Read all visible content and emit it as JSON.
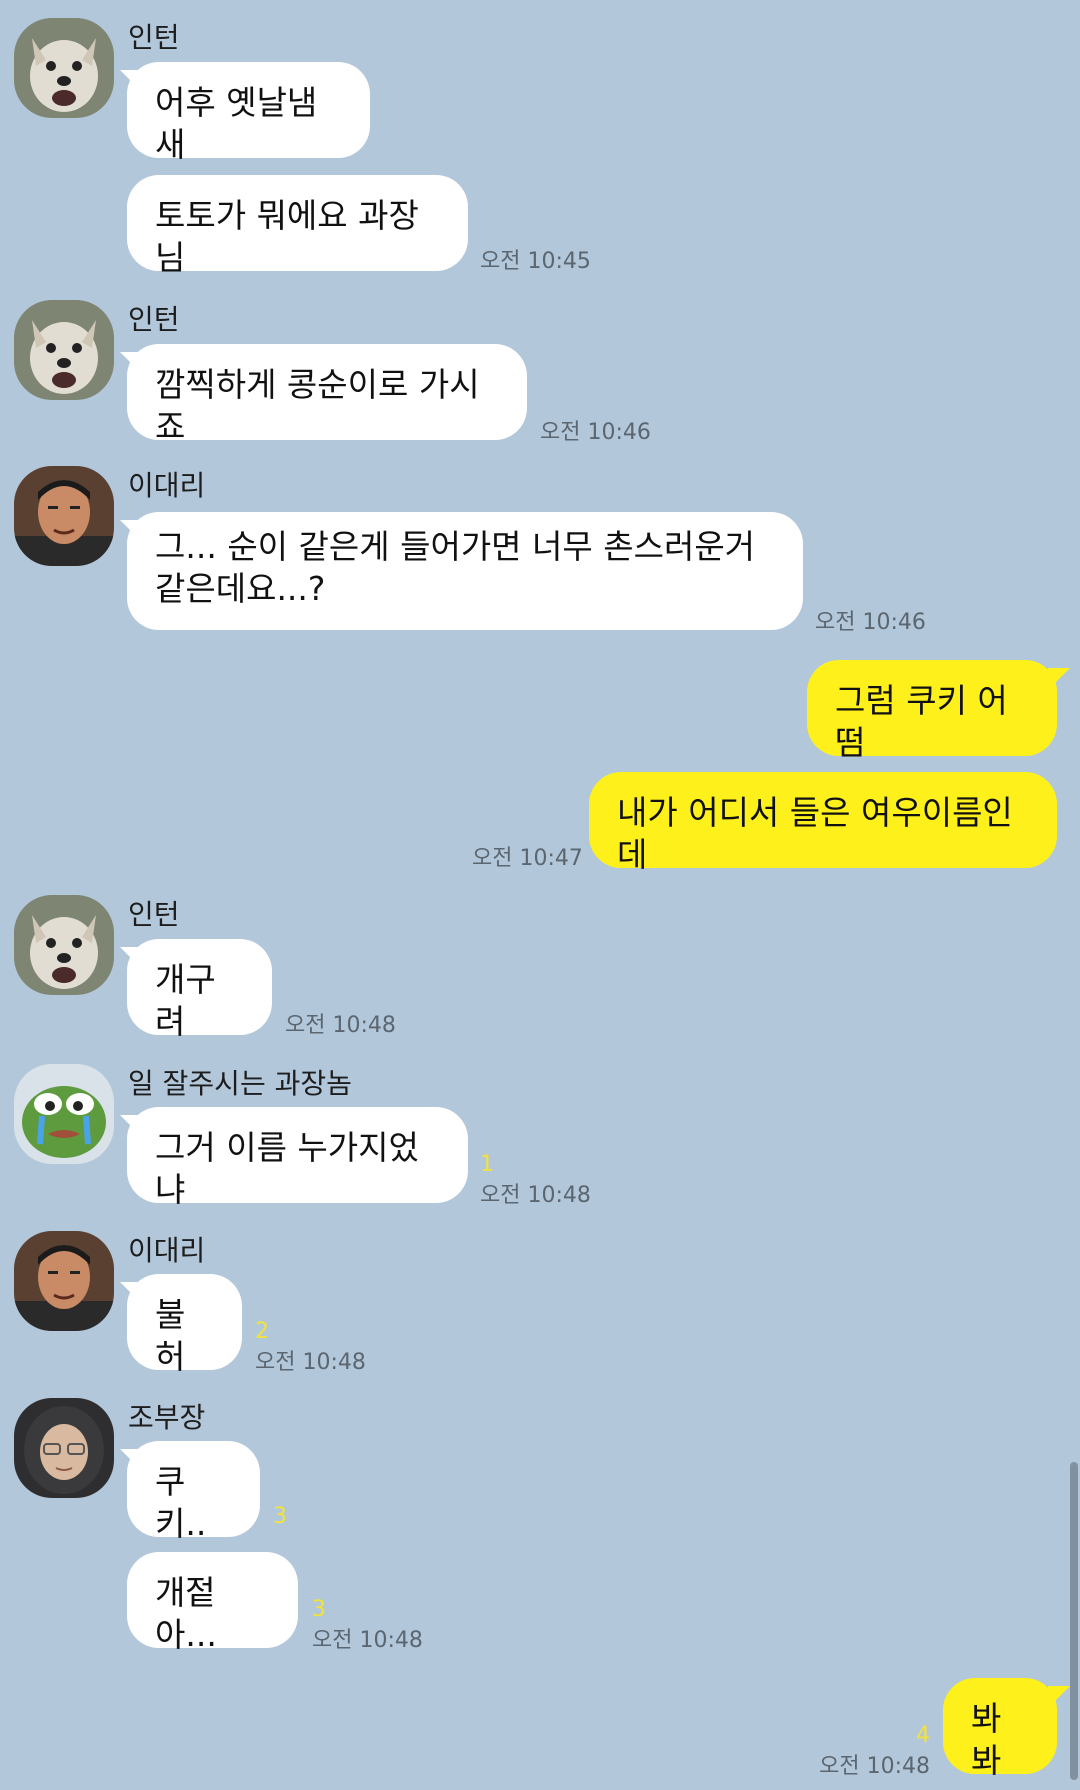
{
  "colors": {
    "background": "#b2c7da",
    "incoming_bubble": "#ffffff",
    "outgoing_bubble": "#fef01b",
    "unread_count": "#f3e23b"
  },
  "messages": [
    {
      "sender": "인턴",
      "avatar": "dog-avatar-icon",
      "bubbles": [
        {
          "text": "어후 옛날냄새"
        },
        {
          "text": "토토가 뭐에요 과장님",
          "time": "오전 10:45"
        }
      ]
    },
    {
      "sender": "인턴",
      "avatar": "dog-avatar-icon",
      "bubbles": [
        {
          "text": "깜찍하게 콩순이로 가시죠",
          "time": "오전 10:46"
        }
      ]
    },
    {
      "sender": "이대리",
      "avatar": "man-avatar-icon",
      "bubbles": [
        {
          "text": "그... 순이 같은게 들어가면 너무 촌스러운거\n같은데요...?",
          "time": "오전 10:46"
        }
      ]
    },
    {
      "sender": "me",
      "bubbles": [
        {
          "text": "그럼 쿠키 어떰"
        },
        {
          "text": "내가 어디서 들은 여우이름인데",
          "time": "오전 10:47"
        }
      ]
    },
    {
      "sender": "인턴",
      "avatar": "dog-avatar-icon",
      "bubbles": [
        {
          "text": "개구려",
          "time": "오전 10:48"
        }
      ]
    },
    {
      "sender": "일 잘주시는 과장놈",
      "avatar": "frog-avatar-icon",
      "bubbles": [
        {
          "text": "그거 이름 누가지었냐",
          "count": "1",
          "time": "오전 10:48"
        }
      ]
    },
    {
      "sender": "이대리",
      "avatar": "man-avatar-icon",
      "bubbles": [
        {
          "text": "불허",
          "count": "2",
          "time": "오전 10:48"
        }
      ]
    },
    {
      "sender": "조부장",
      "avatar": "hooded-avatar-icon",
      "bubbles": [
        {
          "text": "쿠키..",
          "count": "3"
        },
        {
          "text": "개젙아...",
          "count": "3",
          "time": "오전 10:48"
        }
      ]
    },
    {
      "sender": "me",
      "bubbles": [
        {
          "text": "봐봐",
          "count": "4",
          "time": "오전 10:48"
        }
      ]
    }
  ]
}
